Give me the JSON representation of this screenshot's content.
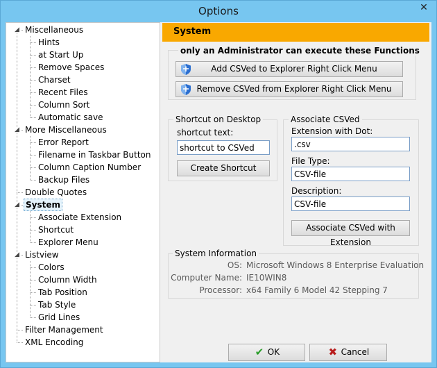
{
  "window": {
    "title": "Options",
    "close_glyph": "✕"
  },
  "tree": {
    "items": [
      {
        "label": "Miscellaneous",
        "level": 0,
        "expander": "minus"
      },
      {
        "label": "Hints",
        "level": 1
      },
      {
        "label": "at Start Up",
        "level": 1
      },
      {
        "label": "Remove Spaces",
        "level": 1
      },
      {
        "label": "Charset",
        "level": 1
      },
      {
        "label": "Recent Files",
        "level": 1
      },
      {
        "label": "Column Sort",
        "level": 1
      },
      {
        "label": "Automatic save",
        "level": 1
      },
      {
        "label": "More Miscellaneous",
        "level": 0,
        "expander": "minus"
      },
      {
        "label": "Error Report",
        "level": 1
      },
      {
        "label": "Filename in Taskbar Button",
        "level": 1
      },
      {
        "label": "Column Caption Number",
        "level": 1
      },
      {
        "label": "Backup Files",
        "level": 1
      },
      {
        "label": "Double Quotes",
        "level": 0
      },
      {
        "label": "System",
        "level": 0,
        "expander": "minus",
        "selected": true
      },
      {
        "label": "Associate Extension",
        "level": 1
      },
      {
        "label": "Shortcut",
        "level": 1
      },
      {
        "label": "Explorer Menu",
        "level": 1
      },
      {
        "label": "Listview",
        "level": 0,
        "expander": "minus"
      },
      {
        "label": "Colors",
        "level": 1
      },
      {
        "label": "Column Width",
        "level": 1
      },
      {
        "label": "Tab Position",
        "level": 1
      },
      {
        "label": "Tab Style",
        "level": 1
      },
      {
        "label": "Grid Lines",
        "level": 1
      },
      {
        "label": "Filter Management",
        "level": 0
      },
      {
        "label": "XML Encoding",
        "level": 0
      }
    ]
  },
  "panel": {
    "header": "System",
    "admin": {
      "title": "only an Administrator can execute these Functions",
      "add_label": "Add CSVed to Explorer Right Click Menu",
      "remove_label": "Remove CSVed from Explorer Right Click Menu"
    },
    "shortcut": {
      "group_label": "Shortcut on Desktop",
      "text_label": "shortcut text:",
      "text_value": "shortcut to CSVed",
      "create_label": "Create Shortcut"
    },
    "associate": {
      "group_label": "Associate CSVed",
      "ext_label": "Extension with Dot:",
      "ext_value": ".csv",
      "filetype_label": "File Type:",
      "filetype_value": "CSV-file",
      "desc_label": "Description:",
      "desc_value": "CSV-file",
      "button_label": "Associate CSVed with Extension"
    },
    "sysinfo": {
      "group_label": "System Information",
      "rows": [
        {
          "label": "OS:",
          "value": "Microsoft Windows 8 Enterprise Evaluation"
        },
        {
          "label": "Computer Name:",
          "value": "IE10WIN8"
        },
        {
          "label": "Processor:",
          "value": "x64 Family 6 Model 42 Stepping 7"
        }
      ]
    }
  },
  "buttons": {
    "ok_label": "OK",
    "ok_icon": "check-icon",
    "cancel_label": "Cancel",
    "cancel_icon": "x-icon",
    "ok_color": "#2a9d2a",
    "cancel_color": "#b81d1d"
  },
  "colors": {
    "header_bg": "#f9a800",
    "title_bar": "#77c6f0"
  }
}
